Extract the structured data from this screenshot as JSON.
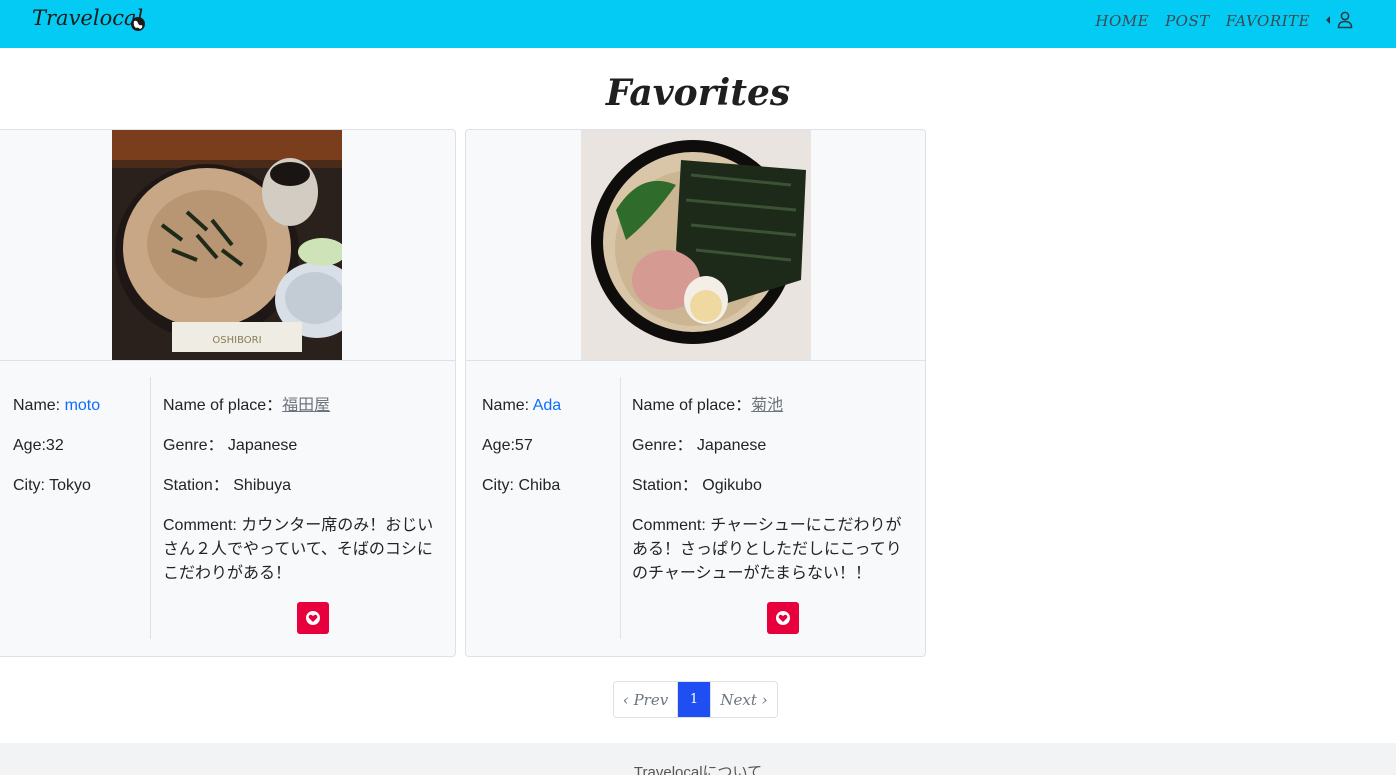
{
  "nav": {
    "brand": "Travelocal",
    "links": [
      "HOME",
      "POST",
      "FAVORITE"
    ]
  },
  "page": {
    "title": "Favorites"
  },
  "cards": [
    {
      "name_label": "Name: ",
      "name": "moto",
      "age": "Age:32",
      "city": "City: Tokyo",
      "place_label": "Name of place：",
      "place": "福田屋",
      "genre": "Genre： Japanese",
      "station": "Station： Shibuya",
      "comment": "Comment: カウンター席のみ！おじいさん２人でやっていて、そばのコシにこだわりがある！"
    },
    {
      "name_label": "Name: ",
      "name": "Ada",
      "age": "Age:57",
      "city": "City: Chiba",
      "place_label": "Name of place：",
      "place": "菊池",
      "genre": "Genre： Japanese",
      "station": "Station： Ogikubo",
      "comment": "Comment: チャーシューにこだわりがある！さっぱりとしただしにこってりのチャーシューがたまらない！！"
    }
  ],
  "pagination": {
    "prev": "‹ Prev",
    "current": "1",
    "next": "Next ›"
  },
  "footer": {
    "text": "Travelocalについて"
  },
  "colors": {
    "navbar": "#03cbf3",
    "heart_button": "#e8003d",
    "active_page": "#1f4ff2",
    "link": "#0d6efd"
  },
  "icons": {
    "brand": "globe-icon",
    "caret": "caret-left-icon",
    "user": "user-icon",
    "heart": "heart-icon"
  }
}
